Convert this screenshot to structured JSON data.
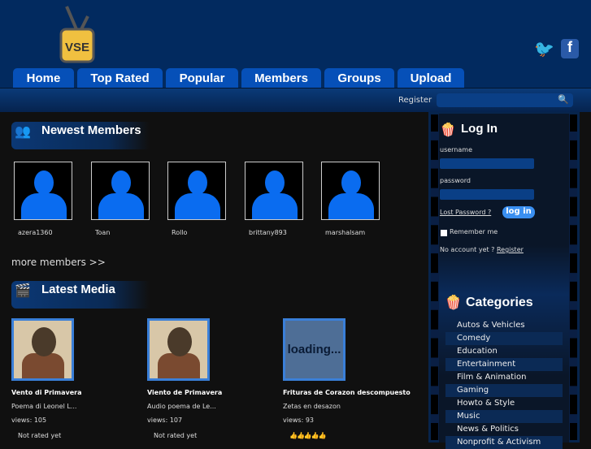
{
  "header": {
    "logo_text": "VSE",
    "tabs": [
      "Home",
      "Top Rated",
      "Popular",
      "Members",
      "Groups",
      "Upload"
    ],
    "social": [
      "twitter-icon",
      "facebook-icon"
    ]
  },
  "subbar": {
    "register": "Register",
    "search_placeholder": ""
  },
  "members": {
    "title": "Newest Members",
    "items": [
      "azera1360",
      "Toan",
      "Rollo",
      "brittany893",
      "marshalsam"
    ],
    "more": "more members >>"
  },
  "media": {
    "title": "Latest Media",
    "items": [
      {
        "title": "Vento di Primavera",
        "desc": "Poema di Leonel L...",
        "views": "views: 105",
        "rating": "Not rated yet"
      },
      {
        "title": "Viento de Primavera",
        "desc": "Audio poema de Le...",
        "views": "views: 107",
        "rating": "Not rated yet"
      },
      {
        "title": "Frituras de Corazon descompuesto",
        "desc": "Zetas en desazon",
        "views": "views: 93",
        "rating": "👍👍👍👍👍",
        "thumb_text": "loading..."
      }
    ]
  },
  "login": {
    "title": "Log In",
    "username_label": "username",
    "password_label": "password",
    "lost_password": "Lost Password ?",
    "button": "log in",
    "remember": "Remember me",
    "no_account": "No account yet ?",
    "register": "Register"
  },
  "categories": {
    "title": "Categories",
    "items": [
      "Autos & Vehicles",
      "Comedy",
      "Education",
      "Entertainment",
      "Film & Animation",
      "Gaming",
      "Howto & Style",
      "Music",
      "News & Politics",
      "Nonprofit & Activism"
    ]
  }
}
